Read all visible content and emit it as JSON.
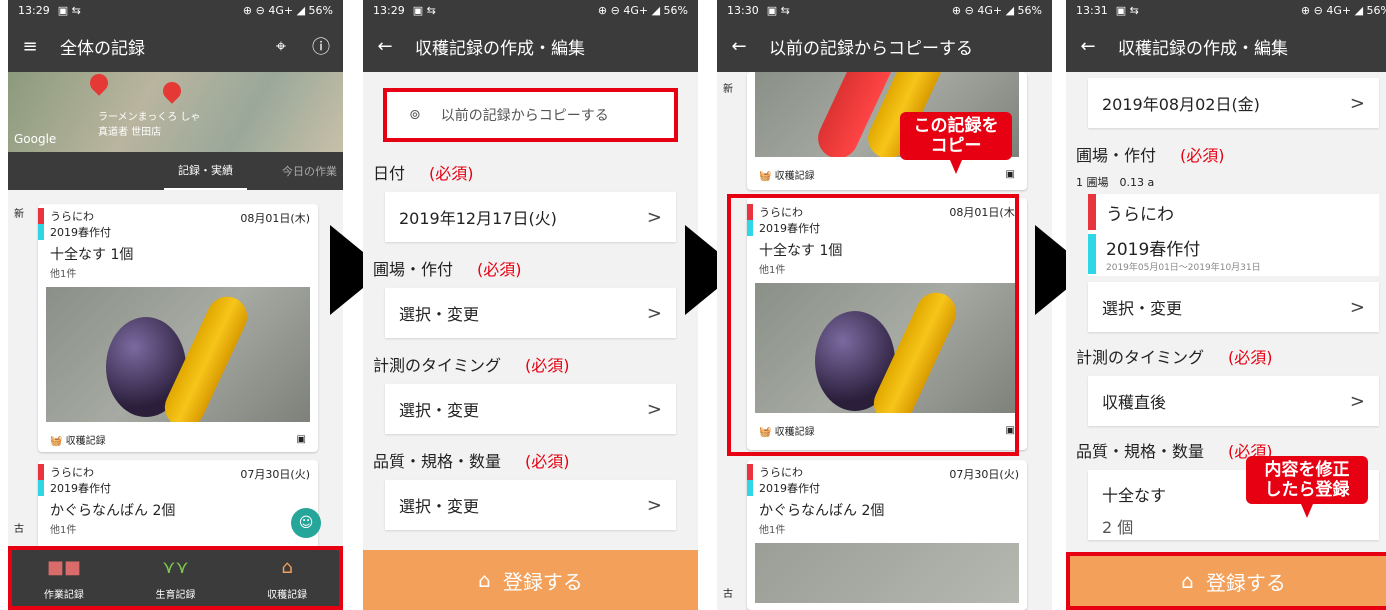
{
  "status": {
    "t1": "13:29",
    "t2": "13:29",
    "t3": "13:30",
    "t4": "13:31",
    "right": "⊕ ⊖ 4G+ ◢ 56%"
  },
  "p1": {
    "title": "全体の記録",
    "map_label": "ラーメンまっくろ しゃ真道者 世田店",
    "google": "Google",
    "tab1": "記録・実績",
    "tab2": "今日の作業",
    "new": "新",
    "old": "古",
    "card1": {
      "tag1": "うらにわ",
      "tag2": "2019春作付",
      "date": "08月01日(木)",
      "title": "十全なす 1個",
      "sub": "他1件",
      "foot": "収穫記録"
    },
    "card2": {
      "tag1": "うらにわ",
      "tag2": "2019春作付",
      "date": "07月30日(火)",
      "title": "かぐらなんばん 2個",
      "sub": "他1件"
    },
    "nav": [
      "作業記録",
      "生育記録",
      "収穫記録"
    ]
  },
  "p2": {
    "title": "収穫記録の作成・編集",
    "copy": "以前の記録からコピーする",
    "date_label": "日付",
    "req": "(必須)",
    "date": "2019年12月17日(火)",
    "field_label": "圃場・作付",
    "select": "選択・変更",
    "timing_label": "計測のタイミング",
    "quality_label": "品質・規格・数量",
    "register": "登録する"
  },
  "p3": {
    "title": "以前の記録からコピーする",
    "new": "新",
    "old": "古",
    "foot": "収穫記録",
    "callout": "この記録を\nコピー",
    "card1": {
      "tag1": "うらにわ",
      "tag2": "2019春作付",
      "date": "08月01日(木)",
      "title": "十全なす 1個",
      "sub": "他1件",
      "foot": "収穫記録"
    },
    "card2": {
      "tag1": "うらにわ",
      "tag2": "2019春作付",
      "date": "07月30日(火)",
      "title": "かぐらなんばん 2個",
      "sub": "他1件"
    }
  },
  "p4": {
    "title": "収穫記録の作成・編集",
    "date": "2019年08月02日(金)",
    "field_label": "圃場・作付",
    "req": "(必須)",
    "plot": "1 圃場　0.13 a",
    "field": "うらにわ",
    "crop": "2019春作付",
    "crop_period": "2019年05月01日〜2019年10月31日",
    "select": "選択・変更",
    "timing_label": "計測のタイミング",
    "timing": "収穫直後",
    "quality_label": "品質・規格・数量",
    "item": "十全なす",
    "qty": "2 個",
    "register": "登録する",
    "callout": "内容を修正\nしたら登録"
  },
  "colors": {
    "accent": "#e60012",
    "bar": "#3b3b3b",
    "button": "#f2a05a",
    "tag_red": "#e8343c",
    "tag_cyan": "#2fd6e6"
  }
}
